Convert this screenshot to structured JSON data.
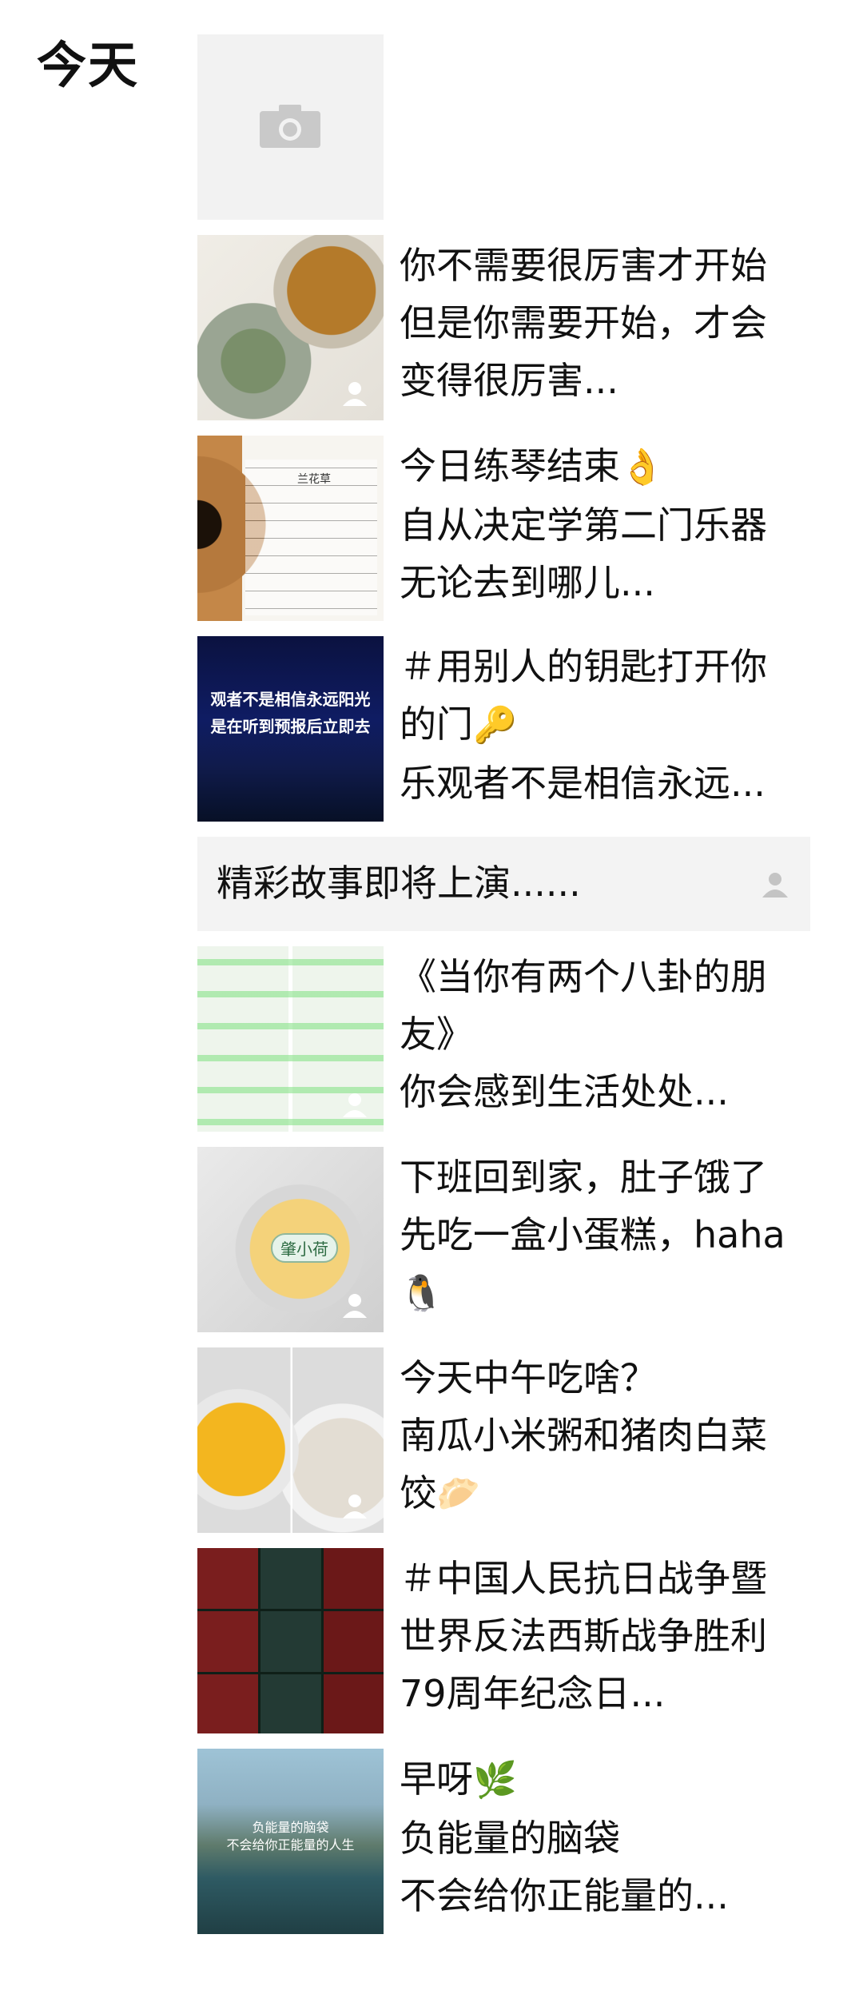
{
  "section": {
    "day_label": "今天"
  },
  "posts": [
    {
      "id": "p0",
      "type": "image-only",
      "thumb_icon": "camera-icon"
    },
    {
      "id": "p1",
      "lines": [
        "你不需要很厉害才开始",
        "但是你需要开始，才会",
        "变得很厉害..."
      ]
    },
    {
      "id": "p2",
      "lines": [
        "今日练琴结束",
        "自从决定学第二门乐器",
        "无论去到哪儿..."
      ],
      "line0_emoji": "👌",
      "thumb_title": "兰花草"
    },
    {
      "id": "p3",
      "lines": [
        "＃用别人的钥匙打开你",
        "的门",
        "乐观者不是相信永远..."
      ],
      "line1_emoji": "🔑",
      "thumb_lines": [
        "观者不是相信永远阳光",
        "是在听到预报后立即去"
      ]
    },
    {
      "id": "banner",
      "type": "text-only",
      "text": "精彩故事即将上演......"
    },
    {
      "id": "p4",
      "lines": [
        "《当你有两个八卦的朋",
        "友》",
        "你会感到生活处处..."
      ]
    },
    {
      "id": "p5",
      "lines": [
        "下班回到家，肚子饿了",
        "先吃一盒小蛋糕，haha",
        ""
      ],
      "line2_emoji": "🐧",
      "thumb_label": "肇小荷"
    },
    {
      "id": "p6",
      "lines": [
        "今天中午吃啥？",
        "南瓜小米粥和猪肉白菜",
        "饺"
      ],
      "line2_emoji": "🥟"
    },
    {
      "id": "p7",
      "lines": [
        "＃中国人民抗日战争暨",
        "世界反法西斯战争胜利",
        "79周年纪念日..."
      ]
    },
    {
      "id": "p8",
      "lines": [
        "早呀",
        "负能量的脑袋",
        "不会给你正能量的..."
      ],
      "line0_emoji": "🌿",
      "thumb_lines": [
        "负能量的脑袋",
        "不会给你正能量的人生"
      ]
    }
  ],
  "colors": {
    "text": "#111111",
    "placeholder_bg": "#f2f2f2",
    "banner_bg": "#f3f3f3",
    "icon_gray": "#c4c4c4"
  }
}
